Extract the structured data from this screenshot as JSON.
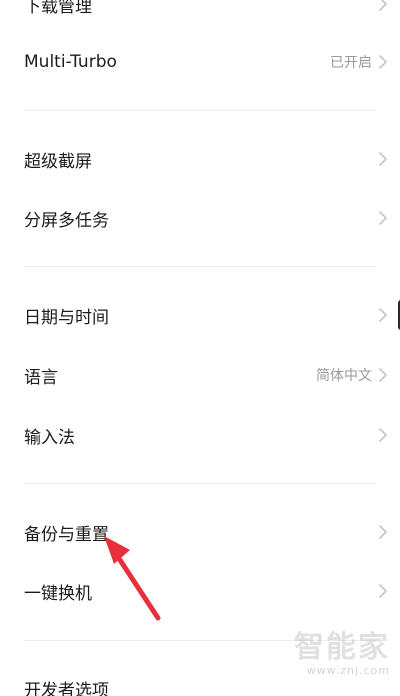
{
  "settings": {
    "items": [
      {
        "label": "下载管理",
        "value": ""
      },
      {
        "label": "Multi-Turbo",
        "value": "已开启"
      },
      {
        "label": "超级截屏",
        "value": ""
      },
      {
        "label": "分屏多任务",
        "value": ""
      },
      {
        "label": "日期与时间",
        "value": ""
      },
      {
        "label": "语言",
        "value": "简体中文"
      },
      {
        "label": "输入法",
        "value": ""
      },
      {
        "label": "备份与重置",
        "value": ""
      },
      {
        "label": "一键换机",
        "value": ""
      },
      {
        "label": "开发者选项",
        "value": ""
      }
    ]
  },
  "watermark": {
    "title": "智能家",
    "url": "www.znj.com"
  },
  "colors": {
    "annotation_arrow": "#e6303a",
    "chevron": "#c4c4c4",
    "value_text": "#9a9a9a"
  }
}
